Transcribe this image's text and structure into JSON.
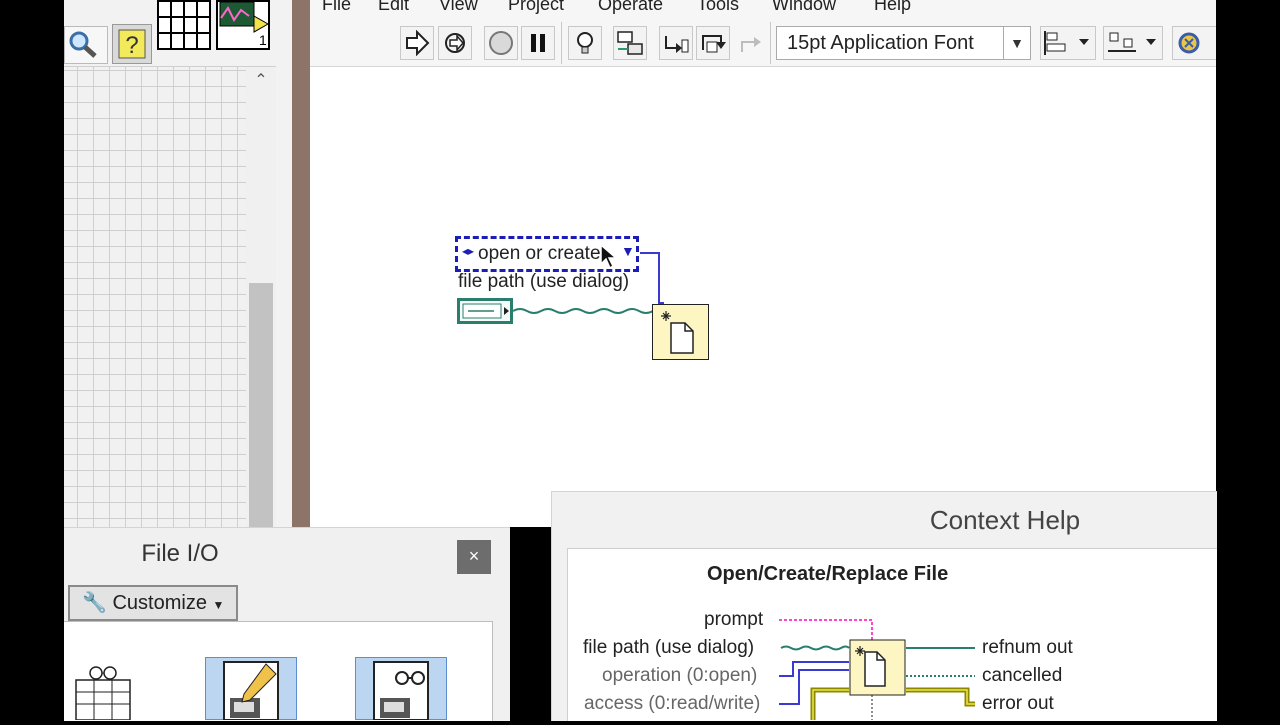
{
  "menu": [
    "File",
    "Edit",
    "View",
    "Project",
    "Operate",
    "Tools",
    "Window",
    "Help"
  ],
  "toolbar": {
    "font_select": "15pt Application Font",
    "run_tooltip": "Run"
  },
  "left_palette": {
    "vi_counter": "1"
  },
  "block_diagram": {
    "enum_value": "open or create",
    "path_label": "file path (use dialog)"
  },
  "file_io": {
    "title": "File I/O",
    "close_glyph": "×",
    "customize_label": "Customize"
  },
  "context_help": {
    "title": "Context Help",
    "function_name": "Open/Create/Replace File",
    "inputs": [
      "prompt",
      "file path (use dialog)",
      "operation (0:open)",
      "access (0:read/write)"
    ],
    "outputs": [
      "refnum out",
      "cancelled",
      "error out"
    ]
  },
  "colors": {
    "divider": "#8d7468",
    "enum_border": "#1c1cb8",
    "path_wire": "#2a7e6e",
    "enum_wire": "#3a3ad0",
    "string_wire": "#ff44d0",
    "error_wire": "#8a8a00",
    "subvi_fill": "#fdf6c3"
  }
}
